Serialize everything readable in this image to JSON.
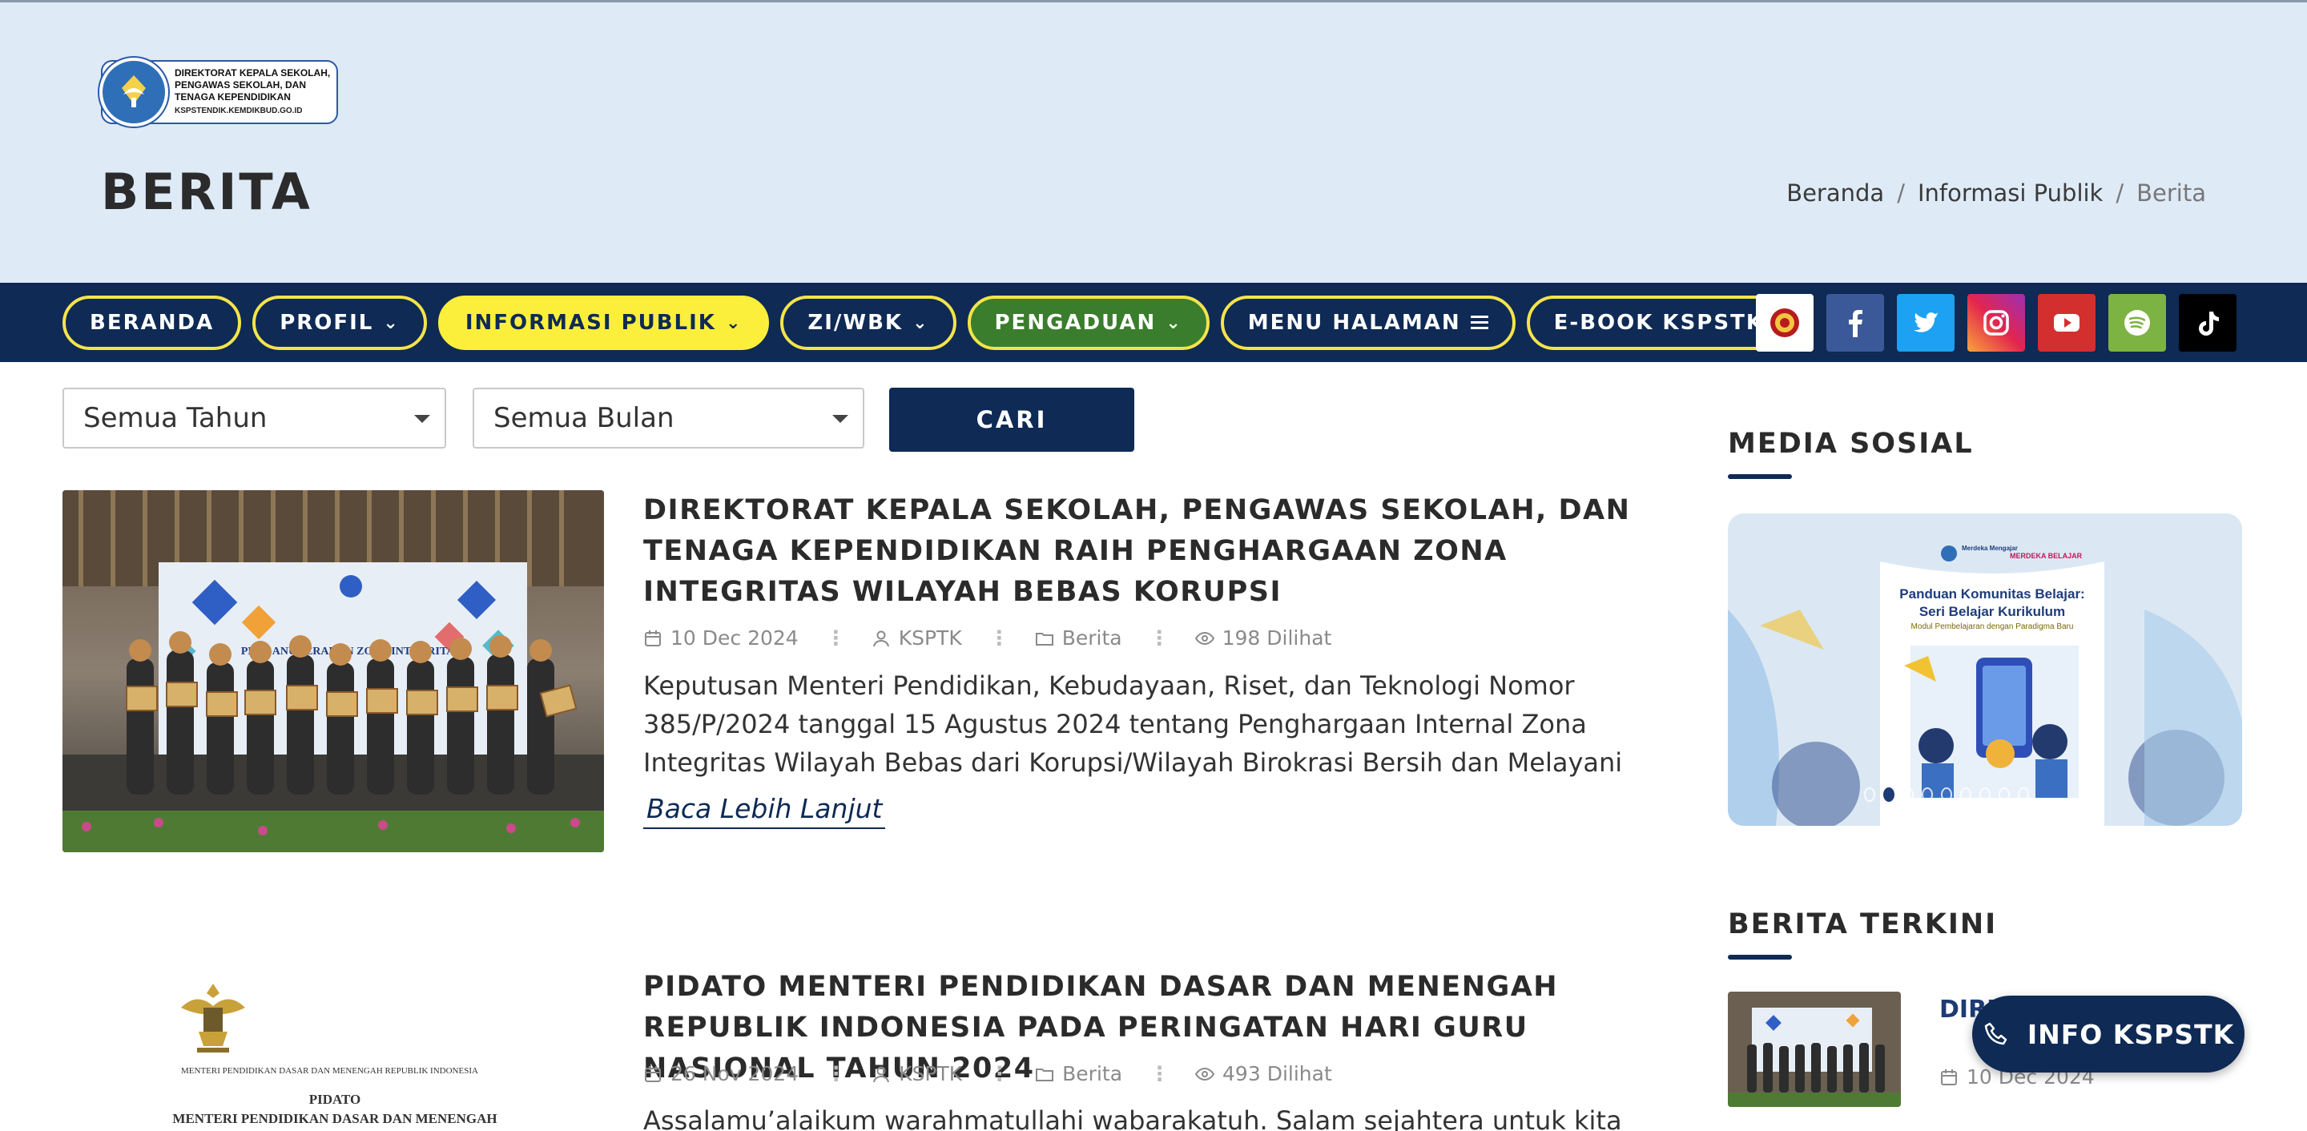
{
  "header": {
    "logo_lines": [
      "DIREKTORAT KEPALA SEKOLAH,",
      "PENGAWAS SEKOLAH, DAN",
      "TENAGA KEPENDIDIKAN"
    ],
    "logo_url": "KSPSTENDIK.KEMDIKBUD.GO.ID",
    "page_title": "BERITA",
    "breadcrumb": [
      "Beranda",
      "Informasi Publik",
      "Berita"
    ],
    "breadcrumb_separator": "/"
  },
  "nav": {
    "items": [
      {
        "label": "BERANDA",
        "chevron": false
      },
      {
        "label": "PROFIL",
        "chevron": true
      },
      {
        "label": "INFORMASI PUBLIK",
        "chevron": true,
        "active": true
      },
      {
        "label": "ZI/WBK",
        "chevron": true
      },
      {
        "label": "PENGADUAN",
        "chevron": true,
        "green": true
      },
      {
        "label": "MENU HALAMAN",
        "menu_icon": true
      },
      {
        "label": "E-BOOK KSPSTK",
        "chevron": false
      }
    ],
    "social": [
      {
        "name": "institution-badge-icon",
        "color": "#ffffff"
      },
      {
        "name": "facebook-icon",
        "color": "#3b5998"
      },
      {
        "name": "twitter-icon",
        "color": "#1da1f2"
      },
      {
        "name": "instagram-icon",
        "color": "#d62976"
      },
      {
        "name": "youtube-icon",
        "color": "#d32f2f"
      },
      {
        "name": "spotify-icon",
        "color": "#7cb342"
      },
      {
        "name": "tiktok-icon",
        "color": "#000000"
      }
    ]
  },
  "filters": {
    "year_value": "Semua Tahun",
    "month_value": "Semua Bulan",
    "search_label": "CARI"
  },
  "articles": [
    {
      "title": "DIREKTORAT KEPALA SEKOLAH, PENGAWAS SEKOLAH, DAN TENAGA KEPENDIDIKAN RAIH PENGHARGAAN ZONA INTEGRITAS WILAYAH BEBAS KORUPSI",
      "date": "10 Dec 2024",
      "author": "KSPTK",
      "category": "Berita",
      "views": "198 Dilihat",
      "excerpt": "Keputusan Menteri Pendidikan, Kebudayaan, Riset, dan Teknologi Nomor 385/P/2024 tanggal 15 Agustus 2024 tentang Penghargaan Internal Zona Integritas Wilayah Bebas dari Korupsi/Wilayah Birokrasi Bersih dan Melayani tela...",
      "read_more": "Baca Lebih Lanjut",
      "banner_text": "PENGANUGERAHAN ZONA INTEGRITAS"
    },
    {
      "title": "PIDATO MENTERI PENDIDIKAN DASAR DAN MENENGAH REPUBLIK INDONESIA PADA PERINGATAN HARI GURU NASIONAL TAHUN 2024",
      "date": "26 Nov 2024",
      "author": "KSPTK",
      "category": "Berita",
      "views": "493 Dilihat",
      "excerpt": "Assalamu’alaikum warahmatullahi wabarakatuh.  Salam sejahtera untuk kita",
      "thumb_caption": "MENTERI PENDIDIKAN DASAR DAN MENENGAH REPUBLIK INDONESIA",
      "thumb_heading": "PIDATO",
      "thumb_heading2": "MENTERI PENDIDIKAN DASAR DAN MENENGAH"
    }
  ],
  "sidebar": {
    "media_title": "MEDIA SOSIAL",
    "poster_brand": "Merdeka Mengajar",
    "poster_brand2": "MERDEKA BELAJAR",
    "poster_title": "Panduan Komunitas Belajar: Seri Belajar Kurikulum",
    "poster_sub": "Modul Pembelajaran dengan Paradigma Baru",
    "recent_title": "BERITA TERKINI",
    "recent_item_title": "DIREKTORAT KEPALA SEKOLAH",
    "recent_item_date": "10 Dec 2024"
  },
  "floating": {
    "info_label": "INFO KSPSTK"
  }
}
